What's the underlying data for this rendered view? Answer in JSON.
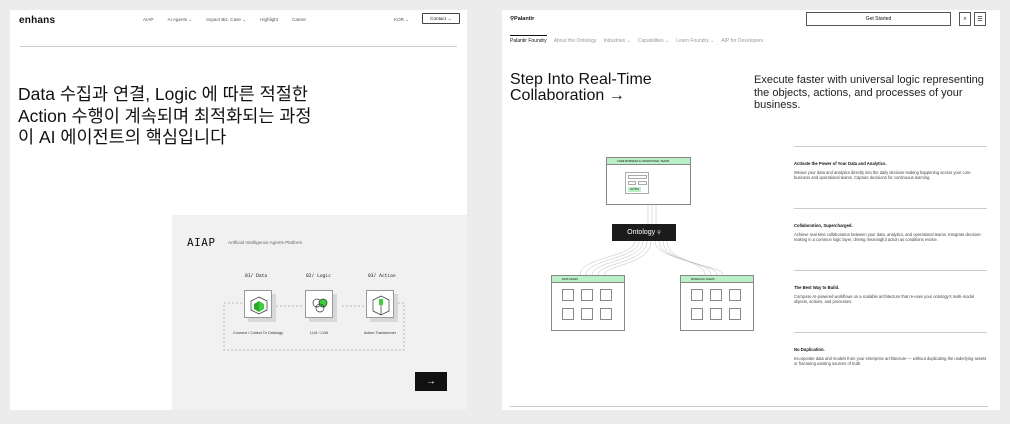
{
  "left": {
    "logo": "enhans",
    "menu": [
      "AIAP",
      "AI Agents ⌄",
      "Impact Biz. Case ⌄",
      "Highlight",
      "Career"
    ],
    "lang": "KOR ⌄",
    "contact": "Contact →",
    "headline": "Data 수집과 연결, Logic 에 따른 적절한 Action 수행이 계속되며 최적화되는 과정이 AI 에이전트의 핵심입니다",
    "aiap": {
      "title": "AIAP",
      "subtitle": "Artificial Intelligence Agents Platform",
      "stages": [
        {
          "label": "01/ Data",
          "caption": "Connect / Collect To Ontology"
        },
        {
          "label": "02/ Logic",
          "caption": "LLM / LVM"
        },
        {
          "label": "03/ Action",
          "caption": "Action Transformer"
        }
      ],
      "next": "→"
    }
  },
  "right": {
    "logo": "Palantir",
    "get_started": "Get Started",
    "tabs": [
      "Palantir Foundry",
      "About the Ontology",
      "Industries ⌄",
      "Capabilities ⌄",
      "Learn Foundry ⌄",
      "AIP for Developers"
    ],
    "headline": "Step Into Real-Time Collaboration →",
    "lead": "Execute faster with universal logic representing the objects, actions, and processes of your business.",
    "diagram": {
      "top_label": "CORE BUSINESS & OPERATIONAL TEAMS",
      "action_label": "ACTION",
      "ontology": "Ontology",
      "left_label": "DATA TEAMS",
      "right_label": "MODELING TEAMS"
    },
    "features": [
      {
        "title": "Activate the Power of Your Data and Analytics.",
        "body": "Weave your data and analytics directly into the daily decision-making happening across your core business and operational teams. Capture decisions for continuous learning."
      },
      {
        "title": "Collaboration, Supercharged.",
        "body": "Achieve real-time collaboration between your data, analytics, and operational teams. Integrate decision-making in a common logic layer, driving meaningful action as conditions evolve."
      },
      {
        "title": "The Best Way to Build.",
        "body": "Compose AI-powered workflows on a scalable architecture that re-uses your ontology's multi-modal objects, actions, and processes."
      },
      {
        "title": "No Duplication.",
        "body": "Incorporate data and models from your enterprise architecture — without duplicating the underlying assets or fracturing existing sources of truth."
      }
    ]
  }
}
